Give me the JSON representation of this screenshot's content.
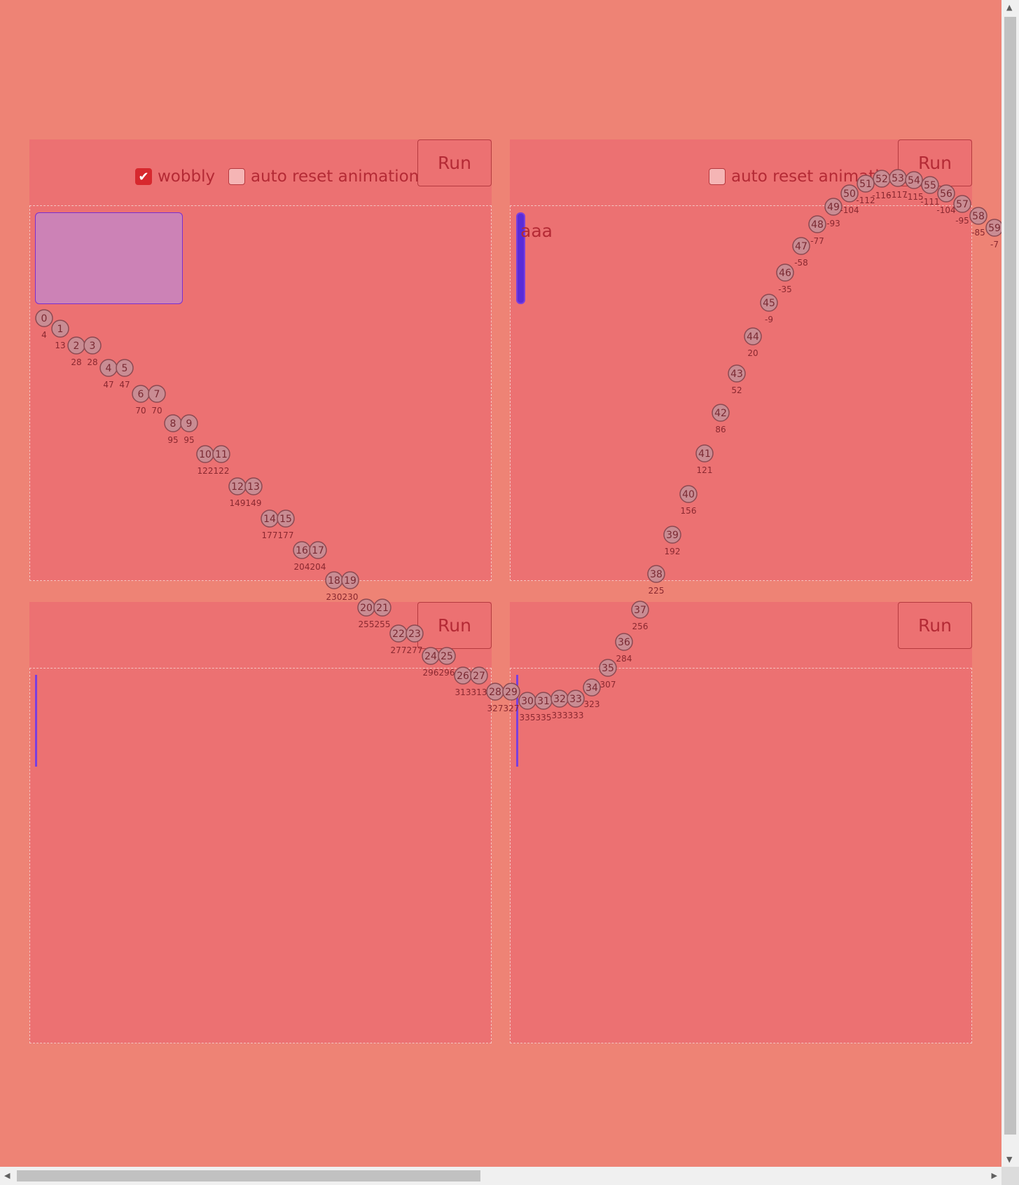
{
  "panels": [
    {
      "run_label": "Run",
      "wobbly_label": "wobbly",
      "wobbly_checked": true,
      "auto_reset_label": "auto reset animation",
      "auto_reset_checked": false
    },
    {
      "run_label": "Run",
      "auto_reset_label": "auto reset animation",
      "auto_reset_checked": false,
      "box_text": "aaa"
    },
    {
      "run_label": "Run"
    },
    {
      "run_label": "Run"
    }
  ],
  "colors": {
    "page_bg": "#ee8375",
    "panel_bg": "#ec7172",
    "box_fill": "#cc82b6",
    "box_border": "#7a2fd0",
    "bar_fill": "#5a2cd8",
    "dot_fill": "#c98c93"
  },
  "trajectory": {
    "points": [
      {
        "i": 0,
        "v": 4
      },
      {
        "i": 1,
        "v": 13
      },
      {
        "i": 2,
        "v": 28
      },
      {
        "i": 3,
        "v": 28
      },
      {
        "i": 4,
        "v": 47
      },
      {
        "i": 5,
        "v": 47
      },
      {
        "i": 6,
        "v": 70
      },
      {
        "i": 7,
        "v": 70
      },
      {
        "i": 8,
        "v": 95
      },
      {
        "i": 9,
        "v": 95
      },
      {
        "i": 10,
        "v": 122
      },
      {
        "i": 11,
        "v": 122
      },
      {
        "i": 12,
        "v": 149
      },
      {
        "i": 13,
        "v": 149
      },
      {
        "i": 14,
        "v": 177
      },
      {
        "i": 15,
        "v": 177
      },
      {
        "i": 16,
        "v": 204
      },
      {
        "i": 17,
        "v": 204
      },
      {
        "i": 18,
        "v": 230
      },
      {
        "i": 19,
        "v": 230
      },
      {
        "i": 20,
        "v": 255
      },
      {
        "i": 21,
        "v": 255
      },
      {
        "i": 22,
        "v": 277
      },
      {
        "i": 23,
        "v": 277
      },
      {
        "i": 24,
        "v": 296
      },
      {
        "i": 25,
        "v": 296
      },
      {
        "i": 26,
        "v": 313
      },
      {
        "i": 27,
        "v": 313
      },
      {
        "i": 28,
        "v": 327
      },
      {
        "i": 29,
        "v": 327
      },
      {
        "i": 30,
        "v": 335
      },
      {
        "i": 31,
        "v": 335
      },
      {
        "i": 32,
        "v": 333
      },
      {
        "i": 33,
        "v": 333
      },
      {
        "i": 34,
        "v": 323
      },
      {
        "i": 35,
        "v": 307
      },
      {
        "i": 36,
        "v": 284
      },
      {
        "i": 37,
        "v": 256
      },
      {
        "i": 38,
        "v": 225
      },
      {
        "i": 39,
        "v": 192
      },
      {
        "i": 40,
        "v": 156
      },
      {
        "i": 41,
        "v": 121
      },
      {
        "i": 42,
        "v": 86
      },
      {
        "i": 43,
        "v": 52
      },
      {
        "i": 44,
        "v": 20
      },
      {
        "i": 45,
        "v": -9
      },
      {
        "i": 46,
        "v": -35
      },
      {
        "i": 47,
        "v": -58
      },
      {
        "i": 48,
        "v": -77
      },
      {
        "i": 49,
        "v": -93
      },
      {
        "i": 50,
        "v": -104
      },
      {
        "i": 51,
        "v": -112
      },
      {
        "i": 52,
        "v": -116
      },
      {
        "i": 53,
        "v": -117
      },
      {
        "i": 54,
        "v": -115
      },
      {
        "i": 55,
        "v": -111
      },
      {
        "i": 56,
        "v": -104
      },
      {
        "i": 57,
        "v": -95
      },
      {
        "i": 58,
        "v": -85
      },
      {
        "i": 59,
        "v": -7
      }
    ]
  }
}
